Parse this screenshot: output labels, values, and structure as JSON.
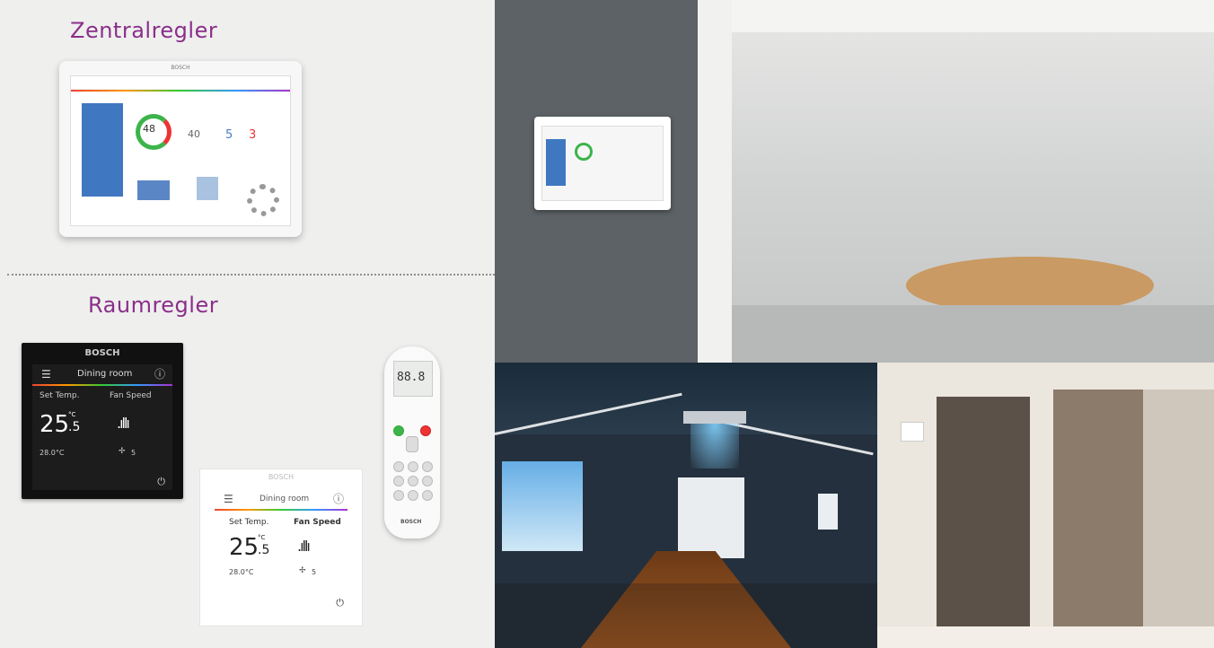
{
  "left_panel": {
    "central_title": "Zentralregler",
    "room_title": "Raumregler"
  },
  "tablet": {
    "brand": "BOSCH",
    "ring_value": "48",
    "stat_1": "40",
    "stat_2": "5",
    "stat_3": "3"
  },
  "black_controller": {
    "brand": "BOSCH",
    "room": "Dining room",
    "set_temp_label": "Set Temp.",
    "fan_speed_label": "Fan Speed",
    "temp_whole": "25",
    "temp_unit": "°C",
    "temp_decimal": ".5",
    "room_temp": "28.0°C",
    "fan_level": "5"
  },
  "white_controller": {
    "brand": "BOSCH",
    "room": "Dining room",
    "set_temp_label": "Set Temp.",
    "fan_speed_label": "Fan Speed",
    "temp_whole": "25",
    "temp_unit": "°C",
    "temp_decimal": ".5",
    "room_temp": "28.0°C",
    "fan_level": "5"
  },
  "remote": {
    "display": "88.8",
    "brand": "BOSCH"
  },
  "colors": {
    "title_purple": "#8a2f8a",
    "left_bg": "#efefee",
    "accent_blue": "#3f78c1",
    "ring_green": "#3cb44b",
    "ring_red": "#e33"
  },
  "icons": [
    "menu-icon",
    "power-icon",
    "fan-icon",
    "home-icon",
    "gear-icon"
  ]
}
